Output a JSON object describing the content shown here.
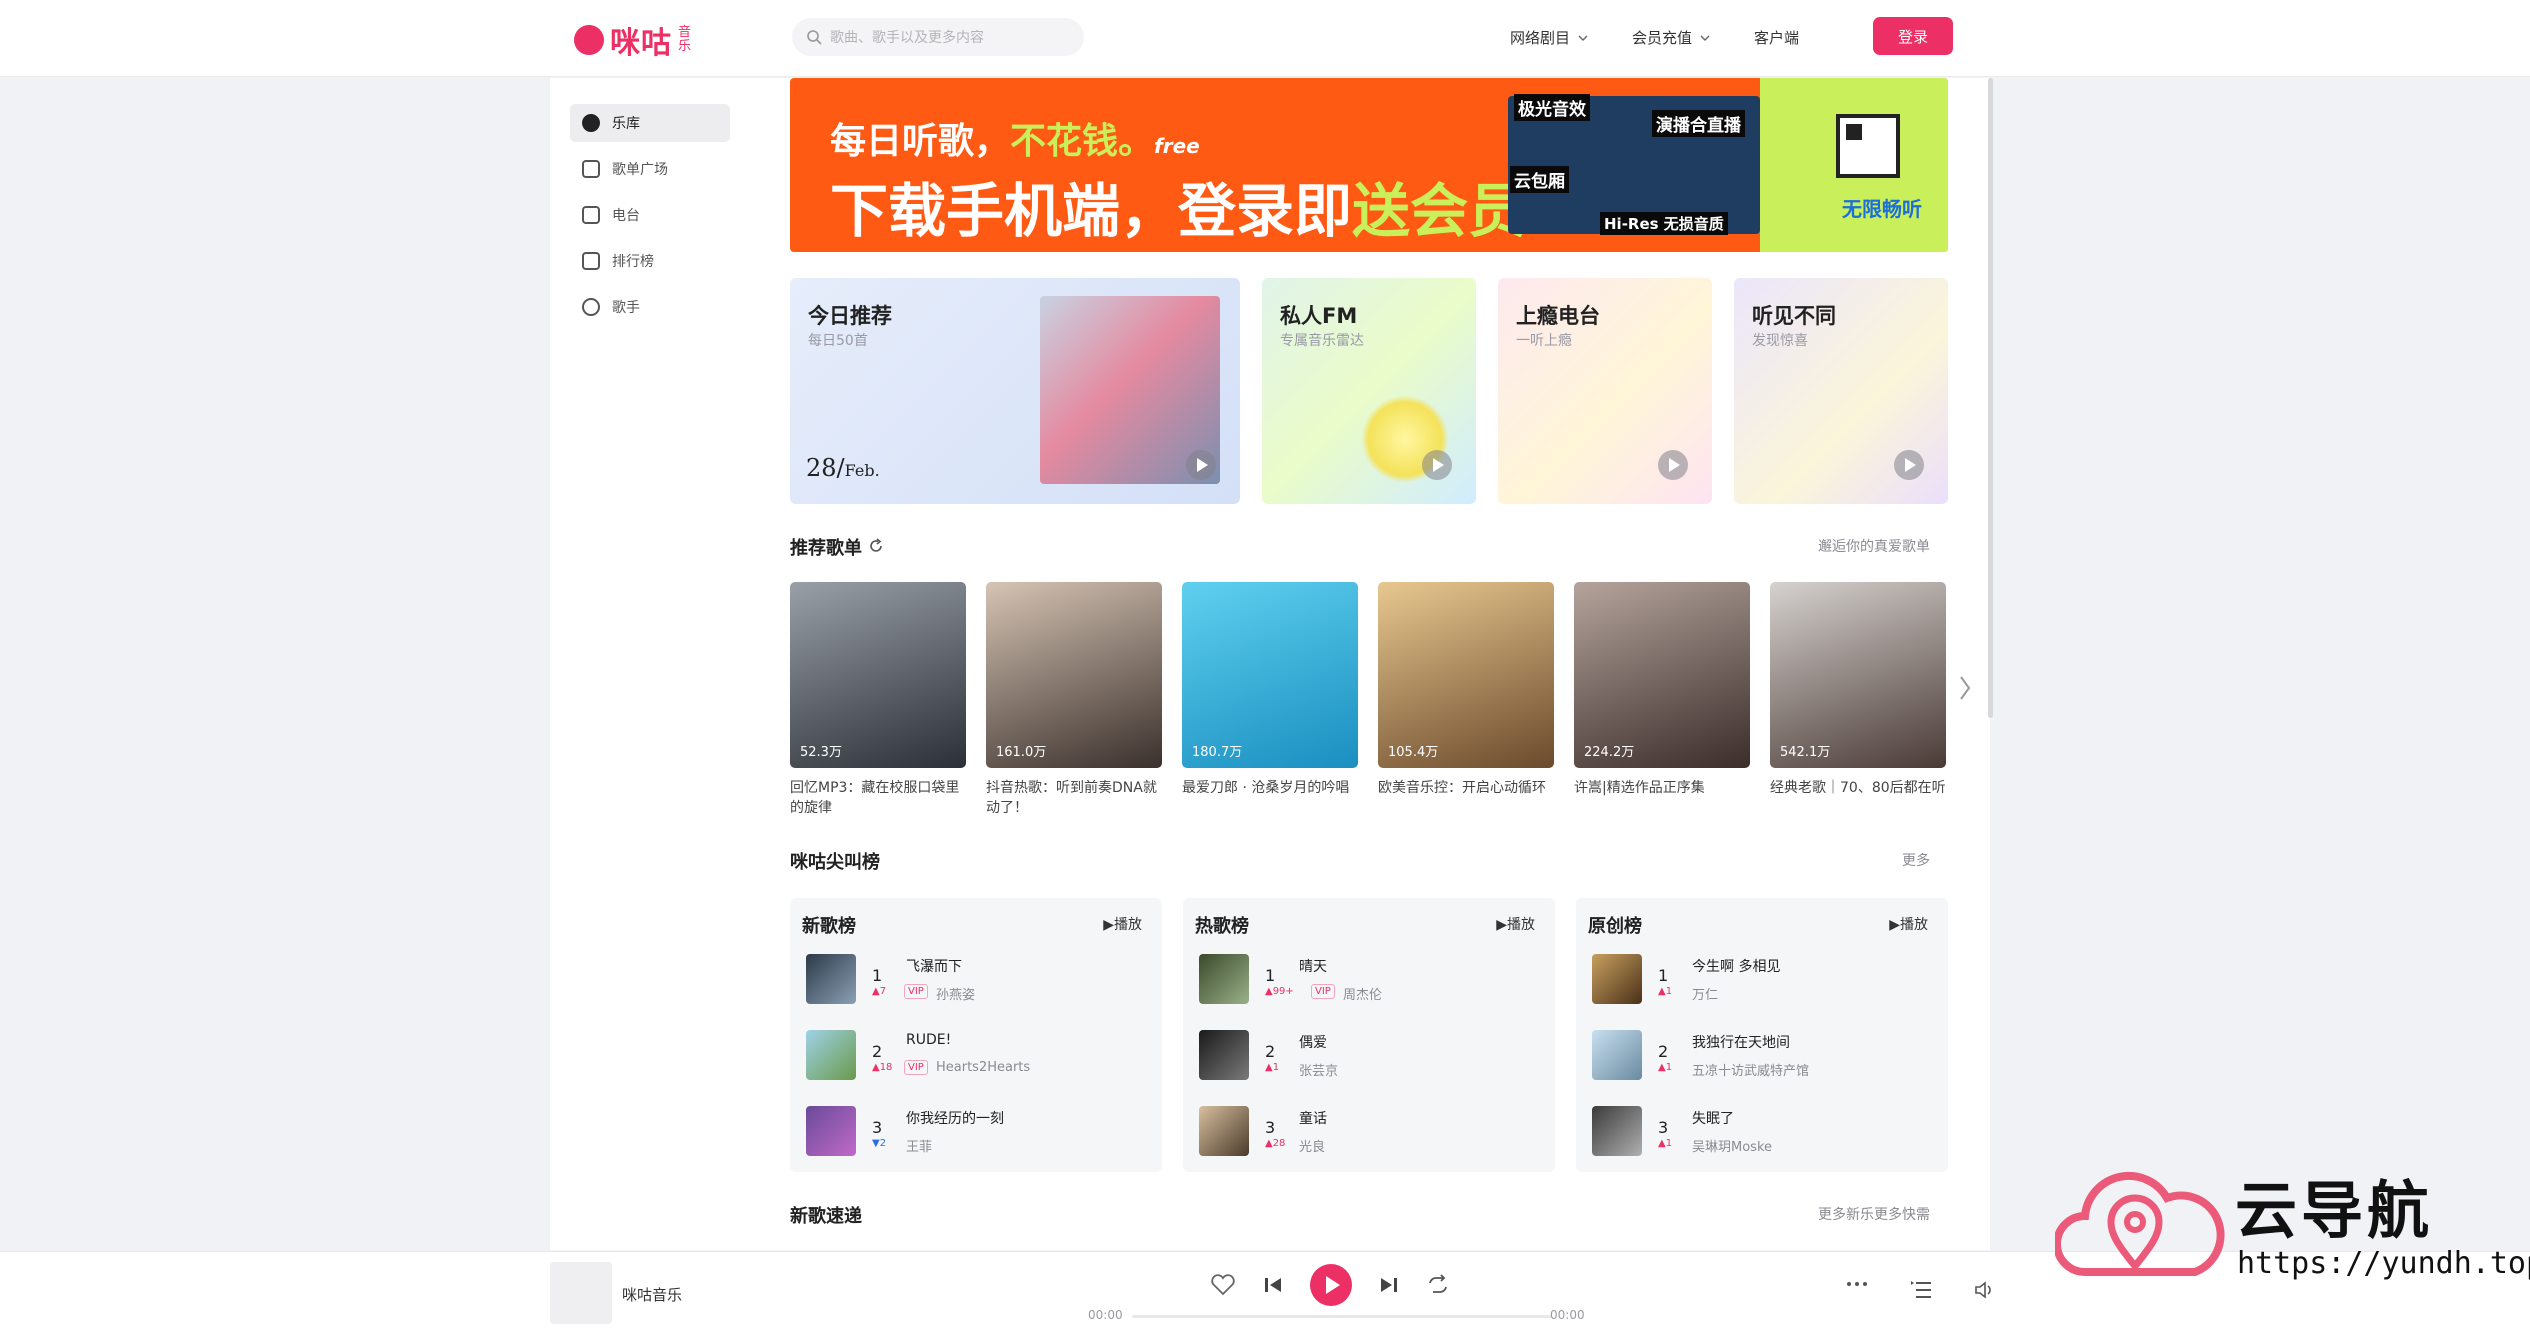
{
  "header": {
    "logo_text": "咪咕",
    "logo_sub": "音乐",
    "search_placeholder": "歌曲、歌手以及更多内容",
    "nav": [
      "网络剧目",
      "会员充值",
      "客户端"
    ],
    "login_label": "登录"
  },
  "sidebar": {
    "items": [
      {
        "label": "乐库",
        "icon": "disc-icon",
        "active": true
      },
      {
        "label": "歌单广场",
        "icon": "music-note-icon",
        "active": false
      },
      {
        "label": "电台",
        "icon": "radio-icon",
        "active": false
      },
      {
        "label": "排行榜",
        "icon": "chart-icon",
        "active": false
      },
      {
        "label": "歌手",
        "icon": "person-icon",
        "active": false
      }
    ]
  },
  "banner": {
    "line1": "每日听歌，",
    "line1_accent": "不花钱。",
    "free": "free",
    "line2": "下载手机端，登录即",
    "line2_accent": "送会员",
    "tags": [
      "极光音效",
      "演播合直播",
      "云包厢",
      "Hi-Res 无损音质"
    ],
    "side_text": "无限畅听"
  },
  "rec_cards": [
    {
      "title": "今日推荐",
      "sub": "每日50首",
      "date_day": "28",
      "date_month": "Feb."
    },
    {
      "title": "私人FM",
      "sub": "专属音乐雷达"
    },
    {
      "title": "上瘾电台",
      "sub": "一听上瘾"
    },
    {
      "title": "听见不同",
      "sub": "发现惊喜"
    }
  ],
  "recommend": {
    "title": "推荐歌单",
    "more": "邂逅你的真爱歌单",
    "playlists": [
      {
        "count": "52.3万",
        "name": "回忆MP3：藏在校服口袋里的旋律"
      },
      {
        "count": "161.0万",
        "name": "抖音热歌：听到前奏DNA就动了！"
      },
      {
        "count": "180.7万",
        "name": "最爱刀郎 · 沧桑岁月的吟唱"
      },
      {
        "count": "105.4万",
        "name": "欧美音乐控：开启心动循环"
      },
      {
        "count": "224.2万",
        "name": "许嵩|精选作品正序集"
      },
      {
        "count": "542.1万",
        "name": "经典老歌｜70、80后都在听"
      }
    ]
  },
  "charts_section": {
    "title": "咪咕尖叫榜",
    "more": "更多",
    "play_label": "播放",
    "charts": [
      {
        "name": "新歌榜",
        "songs": [
          {
            "rank": "1",
            "title": "飞瀑而下",
            "trend": "▲7",
            "vip": "VIP",
            "artist": "孙燕姿"
          },
          {
            "rank": "2",
            "title": "RUDE!",
            "trend": "▲18",
            "vip": "VIP",
            "artist": "Hearts2Hearts"
          },
          {
            "rank": "3",
            "title": "你我经历的一刻",
            "trend": "▼2",
            "vip": "",
            "artist": "王菲"
          }
        ]
      },
      {
        "name": "热歌榜",
        "songs": [
          {
            "rank": "1",
            "title": "晴天",
            "trend": "▲99+",
            "vip": "VIP",
            "artist": "周杰伦"
          },
          {
            "rank": "2",
            "title": "偶爱",
            "trend": "▲1",
            "vip": "",
            "artist": "张芸京"
          },
          {
            "rank": "3",
            "title": "童话",
            "trend": "▲28",
            "vip": "",
            "artist": "光良"
          }
        ]
      },
      {
        "name": "原创榜",
        "songs": [
          {
            "rank": "1",
            "title": "今生啊 多相见",
            "trend": "▲1",
            "vip": "",
            "artist": "万仁"
          },
          {
            "rank": "2",
            "title": "我独行在天地间",
            "trend": "▲1",
            "vip": "",
            "artist": "五凉十访武威特产馆"
          },
          {
            "rank": "3",
            "title": "失眠了",
            "trend": "▲1",
            "vip": "",
            "artist": "吴琳玥Moske"
          }
        ]
      }
    ]
  },
  "new_songs": {
    "title": "新歌速递",
    "more": "更多新乐更多快需"
  },
  "player": {
    "title": "咪咕音乐",
    "time_current": "00:00",
    "time_total": "00:00"
  },
  "watermark": {
    "text": "云导航",
    "url": "https://yundh.top"
  },
  "colors": {
    "accent": "#ec2f64",
    "banner_orange": "#ff5a14",
    "banner_green": "#c9f05b"
  }
}
